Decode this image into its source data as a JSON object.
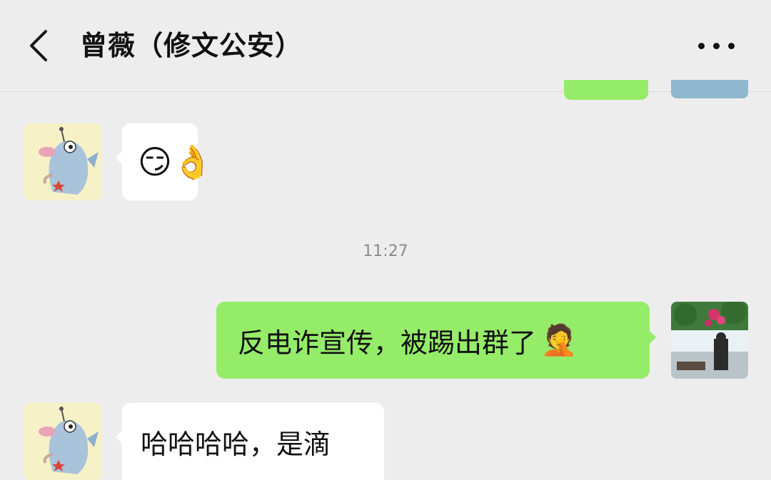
{
  "header": {
    "title": "曾薇（修文公安）",
    "back_icon": "chevron-left-icon",
    "more_icon": "more-dots-icon"
  },
  "messages": [
    {
      "from": "contact",
      "type": "emoji",
      "emoji": "😏👌"
    },
    {
      "type": "timestamp",
      "text": "11:27"
    },
    {
      "from": "me",
      "type": "text",
      "text": "反电诈宣传，被踢出群了",
      "emoji": "🤦"
    },
    {
      "from": "contact",
      "type": "text",
      "text": "哈哈哈哈，是滴"
    }
  ],
  "colors": {
    "background": "#ededed",
    "bubble_self": "#95ec69",
    "bubble_contact": "#ffffff"
  }
}
